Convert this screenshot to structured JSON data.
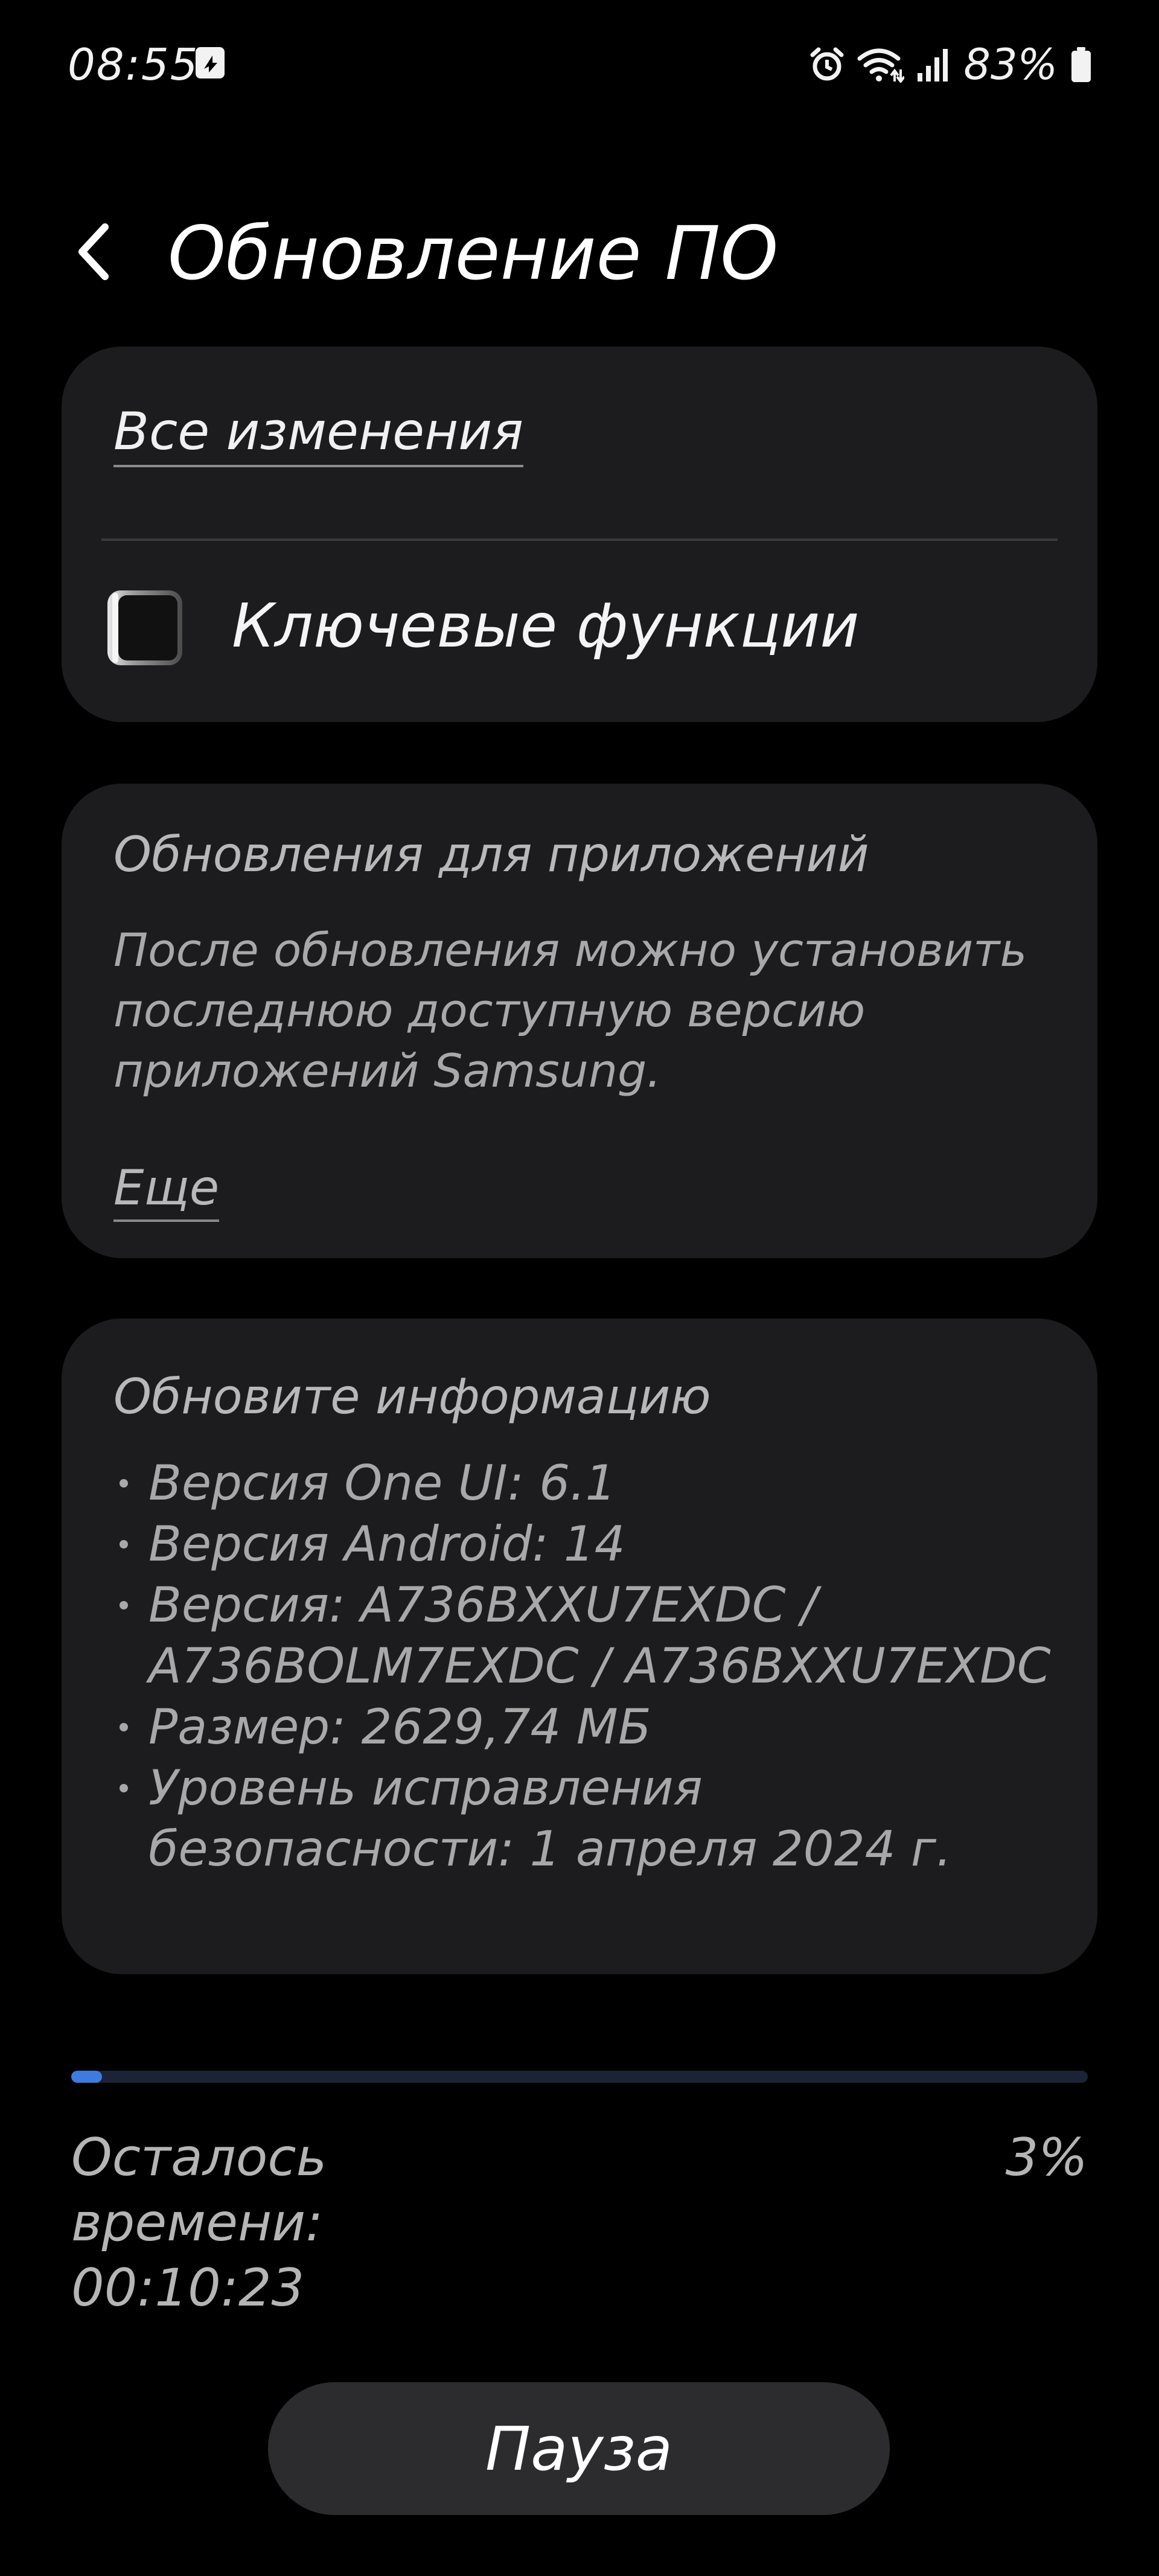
{
  "status_bar": {
    "time": "08:55",
    "battery_percent": "83%",
    "icons": [
      "notification-icon",
      "alarm-icon",
      "wifi-icon",
      "signal-icon",
      "battery-icon"
    ]
  },
  "header": {
    "title": "Обновление ПО",
    "back_icon": "back-chevron-icon"
  },
  "changes_card": {
    "all_changes_label": "Все изменения",
    "key_features_label": "Ключевые функции",
    "key_features_icon": "phone-icon"
  },
  "apps_card": {
    "heading": "Обновления для приложений",
    "body": "После обновления можно установить последнюю доступную версию приложений Samsung.",
    "more_label": "Еще"
  },
  "info_card": {
    "heading": "Обновите информацию",
    "items": [
      "Версия One UI: 6.1",
      "Версия Android: 14",
      "Версия: A736BXXU7EXDC / A736BOLM7EXDC / A736BXXU7EXDC",
      "Размер: 2629,74 МБ",
      "Уровень исправления безопасности: 1 апреля 2024 г."
    ]
  },
  "progress": {
    "value_percent": 3,
    "percent_label": "3%",
    "remaining_label": "Осталось времени:",
    "remaining_time": "00:10:23"
  },
  "actions": {
    "pause_label": "Пауза"
  },
  "colors": {
    "background": "#000000",
    "card": "#1c1c1e",
    "progress_fill": "#3e7be0",
    "progress_track": "#1a2436",
    "button": "#2c2c2e"
  }
}
